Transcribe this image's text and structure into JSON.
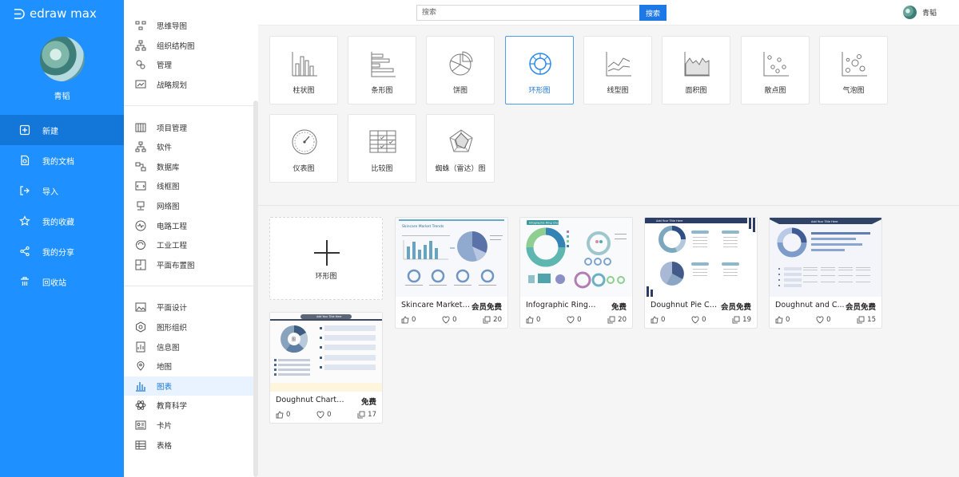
{
  "app": {
    "logo_text": "edraw max"
  },
  "user": {
    "name": "青韬"
  },
  "nav": {
    "items": [
      {
        "label": "新建",
        "icon": "new-file-icon"
      },
      {
        "label": "我的文档",
        "icon": "documents-icon"
      },
      {
        "label": "导入",
        "icon": "import-icon"
      },
      {
        "label": "我的收藏",
        "icon": "star-icon"
      },
      {
        "label": "我的分享",
        "icon": "share-icon"
      },
      {
        "label": "回收站",
        "icon": "trash-icon"
      }
    ],
    "active": "新建"
  },
  "categories": {
    "group1": [
      {
        "label": "思维导图",
        "icon": "mindmap-icon"
      },
      {
        "label": "组织结构图",
        "icon": "org-chart-icon"
      },
      {
        "label": "管理",
        "icon": "management-icon"
      },
      {
        "label": "战略规划",
        "icon": "strategy-icon"
      }
    ],
    "group2": [
      {
        "label": "项目管理",
        "icon": "project-icon"
      },
      {
        "label": "软件",
        "icon": "software-icon"
      },
      {
        "label": "数据库",
        "icon": "database-icon"
      },
      {
        "label": "线框图",
        "icon": "wireframe-icon"
      },
      {
        "label": "网络图",
        "icon": "network-icon"
      },
      {
        "label": "电路工程",
        "icon": "circuit-icon"
      },
      {
        "label": "工业工程",
        "icon": "industrial-icon"
      },
      {
        "label": "平面布置图",
        "icon": "floorplan-icon"
      }
    ],
    "group3": [
      {
        "label": "平面设计",
        "icon": "graphic-design-icon"
      },
      {
        "label": "图形组织",
        "icon": "graphic-organizer-icon"
      },
      {
        "label": "信息图",
        "icon": "infographic-icon"
      },
      {
        "label": "地图",
        "icon": "map-icon"
      },
      {
        "label": "图表",
        "icon": "chart-icon"
      },
      {
        "label": "教育科学",
        "icon": "science-icon"
      },
      {
        "label": "卡片",
        "icon": "card-icon"
      },
      {
        "label": "表格",
        "icon": "table-icon"
      }
    ],
    "active": "图表"
  },
  "search": {
    "placeholder": "搜索",
    "button": "搜索"
  },
  "chart_types": [
    {
      "label": "柱状图",
      "icon": "column-chart-icon"
    },
    {
      "label": "条形图",
      "icon": "bar-chart-icon"
    },
    {
      "label": "饼图",
      "icon": "pie-chart-icon"
    },
    {
      "label": "环形图",
      "icon": "doughnut-chart-icon"
    },
    {
      "label": "线型图",
      "icon": "line-chart-icon"
    },
    {
      "label": "面积图",
      "icon": "area-chart-icon"
    },
    {
      "label": "散点图",
      "icon": "scatter-chart-icon"
    },
    {
      "label": "气泡图",
      "icon": "bubble-chart-icon"
    },
    {
      "label": "仪表图",
      "icon": "gauge-chart-icon"
    },
    {
      "label": "比较图",
      "icon": "comparison-chart-icon"
    },
    {
      "label": "蜘蛛（雷达）图",
      "icon": "radar-chart-icon"
    }
  ],
  "chart_types_active": "环形图",
  "new_template": {
    "label": "环形图"
  },
  "templates": [
    {
      "title": "Skincare Market ...",
      "badge": "会员免费",
      "likes": "0",
      "favorites": "0",
      "copies": "20",
      "thumb_heading": "Skincare Market Trends"
    },
    {
      "title": "Infographic Ring Cha...",
      "badge": "免费",
      "likes": "0",
      "favorites": "0",
      "copies": "20",
      "thumb_heading": "Infographic Ring Chart"
    },
    {
      "title": "Doughnut Pie Ch...",
      "badge": "会员免费",
      "likes": "0",
      "favorites": "0",
      "copies": "19",
      "thumb_heading": "Add Your Title Here"
    },
    {
      "title": "Doughnut and C...",
      "badge": "会员免费",
      "likes": "0",
      "favorites": "0",
      "copies": "15",
      "thumb_heading": "Add Your Title Here"
    },
    {
      "title": "Doughnut Chart and ...",
      "badge": "免费",
      "likes": "0",
      "favorites": "0",
      "copies": "17",
      "thumb_heading": "Add Your Title Here"
    }
  ]
}
